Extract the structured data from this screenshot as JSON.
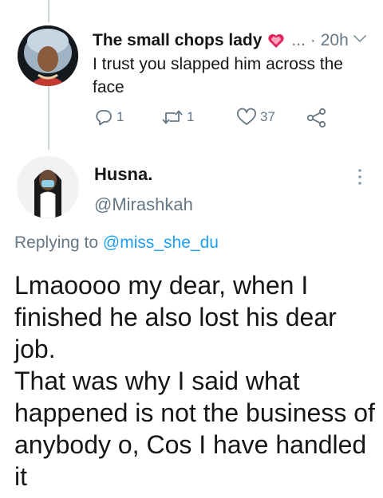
{
  "parent_tweet": {
    "display_name": "The small chops lady",
    "name_emoji": "heart-emoji",
    "ellipsis": "...",
    "timestamp": "· 20h",
    "text": "I trust you slapped him across the face",
    "actions": {
      "reply_count": "1",
      "retweet_count": "1",
      "like_count": "37"
    }
  },
  "tweet": {
    "display_name": "Husna.",
    "handle": "@Mirashkah",
    "replying_prefix": "Replying to",
    "replying_to": "@miss_she_du",
    "body_lines": [
      "Lmaoooo my dear, when I finished he also lost his dear job.",
      "That was why I said what happened is not the business of anybody o, Cos I have handled it"
    ]
  },
  "colors": {
    "text": "#14171a",
    "secondary": "#657786",
    "link": "#1da1f2",
    "thread_line": "#ccd6dd",
    "heart_emoji": "#e0245e"
  },
  "icons": [
    "reply-icon",
    "retweet-icon",
    "like-icon",
    "share-icon",
    "chevron-down-icon",
    "more-vertical-icon"
  ]
}
